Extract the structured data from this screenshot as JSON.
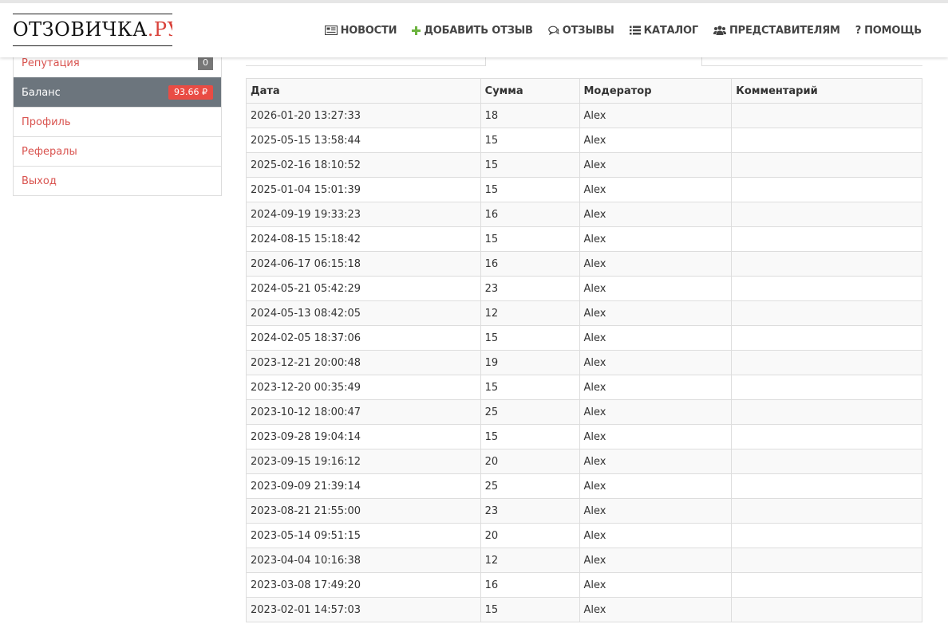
{
  "logo": {
    "main": "ОТЗОВИЧКА",
    "accent": ".РУ"
  },
  "nav": [
    {
      "label": "НОВОСТИ",
      "icon": "newspaper-icon"
    },
    {
      "label": "ДОБАВИТЬ ОТЗЫВ",
      "icon": "plus-icon"
    },
    {
      "label": "ОТЗЫВЫ",
      "icon": "comments-icon"
    },
    {
      "label": "КАТАЛОГ",
      "icon": "list-icon"
    },
    {
      "label": "ПРЕДСТАВИТЕЛЯМ",
      "icon": "users-icon"
    },
    {
      "label": "ПОМОЩЬ",
      "icon": "question-icon"
    }
  ],
  "sidebar": {
    "items": [
      {
        "label": "Репутация",
        "badge": "0"
      },
      {
        "label": "Баланс",
        "badge": "93.66 ₽"
      },
      {
        "label": "Профиль"
      },
      {
        "label": "Рефералы"
      },
      {
        "label": "Выход"
      }
    ]
  },
  "table": {
    "headers": [
      "Дата",
      "Сумма",
      "Модератор",
      "Комментарий"
    ],
    "rows": [
      [
        "2026-01-20 13:27:33",
        "18",
        "Alex",
        ""
      ],
      [
        "2025-05-15 13:58:44",
        "15",
        "Alex",
        ""
      ],
      [
        "2025-02-16 18:10:52",
        "15",
        "Alex",
        ""
      ],
      [
        "2025-01-04 15:01:39",
        "15",
        "Alex",
        ""
      ],
      [
        "2024-09-19 19:33:23",
        "16",
        "Alex",
        ""
      ],
      [
        "2024-08-15 15:18:42",
        "15",
        "Alex",
        ""
      ],
      [
        "2024-06-17 06:15:18",
        "16",
        "Alex",
        ""
      ],
      [
        "2024-05-21 05:42:29",
        "23",
        "Alex",
        ""
      ],
      [
        "2024-05-13 08:42:05",
        "12",
        "Alex",
        ""
      ],
      [
        "2024-02-05 18:37:06",
        "15",
        "Alex",
        ""
      ],
      [
        "2023-12-21 20:00:48",
        "19",
        "Alex",
        ""
      ],
      [
        "2023-12-20 00:35:49",
        "15",
        "Alex",
        ""
      ],
      [
        "2023-10-12 18:00:47",
        "25",
        "Alex",
        ""
      ],
      [
        "2023-09-28 19:04:14",
        "15",
        "Alex",
        ""
      ],
      [
        "2023-09-15 19:16:12",
        "20",
        "Alex",
        ""
      ],
      [
        "2023-09-09 21:39:14",
        "25",
        "Alex",
        ""
      ],
      [
        "2023-08-21 21:55:00",
        "23",
        "Alex",
        ""
      ],
      [
        "2023-05-14 09:51:15",
        "20",
        "Alex",
        ""
      ],
      [
        "2023-04-04 10:16:38",
        "12",
        "Alex",
        ""
      ],
      [
        "2023-03-08 17:49:20",
        "16",
        "Alex",
        ""
      ],
      [
        "2023-02-01 14:57:03",
        "15",
        "Alex",
        ""
      ]
    ]
  },
  "colors": {
    "accent": "#d9423a",
    "active_bg": "#6c757d",
    "link": "#d9534f",
    "plus": "#6cb33f"
  }
}
